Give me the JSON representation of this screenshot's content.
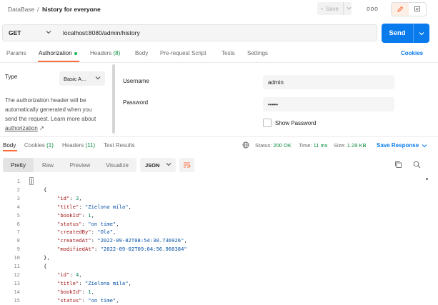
{
  "header": {
    "breadcrumb_root": "DataBase",
    "breadcrumb_sep": "/",
    "title": "history for everyone",
    "save_label": "Save",
    "more_label": "ooo"
  },
  "request": {
    "method": "GET",
    "url": "localhost:8080/admin/history",
    "send_label": "Send"
  },
  "request_tabs": {
    "params": "Params",
    "authorization": "Authorization",
    "headers": "Headers",
    "headers_count": "(8)",
    "body": "Body",
    "prerequest": "Pre-request Script",
    "tests": "Tests",
    "settings": "Settings",
    "cookies": "Cookies"
  },
  "auth": {
    "type_label": "Type",
    "type_value": "Basic A...",
    "desc_1": "The authorization header will be",
    "desc_2": "automatically generated when you",
    "desc_3": "send the request. Learn more about",
    "desc_link": "authorization",
    "desc_arrow": "↗",
    "username_label": "Username",
    "username_value": "admin",
    "password_label": "Password",
    "password_value": "•••••",
    "show_password_label": "Show Password"
  },
  "response_tabs": {
    "body": "Body",
    "cookies": "Cookies",
    "cookies_count": "(1)",
    "headers": "Headers",
    "headers_count": "(11)",
    "test_results": "Test Results"
  },
  "response_meta": {
    "status_label": "Status:",
    "status_value": "200 OK",
    "time_label": "Time:",
    "time_value": "11 ms",
    "size_label": "Size:",
    "size_value": "1.29 KB",
    "save_response": "Save Response"
  },
  "view": {
    "pretty": "Pretty",
    "raw": "Raw",
    "preview": "Preview",
    "visualize": "Visualize",
    "format": "JSON"
  },
  "code_lines": [
    {
      "n": "1",
      "indent": 0,
      "t": "bracket",
      "v": "["
    },
    {
      "n": "2",
      "indent": 1,
      "t": "punct",
      "v": "{"
    },
    {
      "n": "3",
      "indent": 2,
      "t": "kv",
      "k": "\"id\"",
      "v": "3",
      "vt": "n"
    },
    {
      "n": "4",
      "indent": 2,
      "t": "kv",
      "k": "\"title\"",
      "v": "\"Zielona mila\"",
      "vt": "s"
    },
    {
      "n": "5",
      "indent": 2,
      "t": "kv",
      "k": "\"bookId\"",
      "v": "1",
      "vt": "n"
    },
    {
      "n": "6",
      "indent": 2,
      "t": "kv",
      "k": "\"status\"",
      "v": "\"on time\"",
      "vt": "s"
    },
    {
      "n": "7",
      "indent": 2,
      "t": "kv",
      "k": "\"createdBy\"",
      "v": "\"Ola\"",
      "vt": "s"
    },
    {
      "n": "8",
      "indent": 2,
      "t": "kv",
      "k": "\"createdAt\"",
      "v": "\"2022-09-02T08:54:30.736926\"",
      "vt": "s"
    },
    {
      "n": "9",
      "indent": 2,
      "t": "kvlast",
      "k": "\"modifiedAt\"",
      "v": "\"2022-09-02T09:04:56.960384\"",
      "vt": "s"
    },
    {
      "n": "10",
      "indent": 1,
      "t": "punct",
      "v": "},"
    },
    {
      "n": "11",
      "indent": 1,
      "t": "punct",
      "v": "{"
    },
    {
      "n": "12",
      "indent": 2,
      "t": "kv",
      "k": "\"id\"",
      "v": "4",
      "vt": "n"
    },
    {
      "n": "13",
      "indent": 2,
      "t": "kv",
      "k": "\"title\"",
      "v": "\"Zielona mila\"",
      "vt": "s"
    },
    {
      "n": "14",
      "indent": 2,
      "t": "kv",
      "k": "\"bookId\"",
      "v": "1",
      "vt": "n"
    },
    {
      "n": "15",
      "indent": 2,
      "t": "kv",
      "k": "\"status\"",
      "v": "\"on time\"",
      "vt": "s"
    }
  ],
  "colors": {
    "accent": "#ff6c37",
    "primary": "#097bed",
    "status_ok": "#0a8a3c",
    "json_key": "#a31515",
    "json_string": "#0451a5",
    "json_number": "#098658"
  }
}
